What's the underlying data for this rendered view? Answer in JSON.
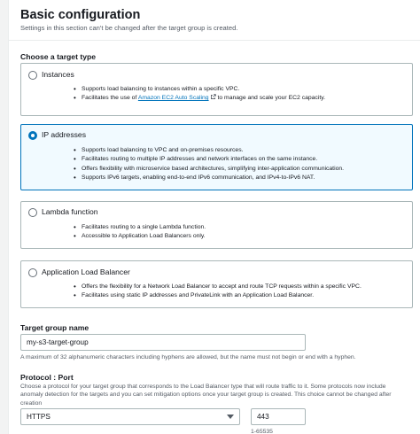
{
  "header": {
    "title": "Basic configuration",
    "subtitle": "Settings in this section can't be changed after the target group is created."
  },
  "target_type": {
    "label": "Choose a target type",
    "options": [
      {
        "label": "Instances",
        "selected": false,
        "bullets": [
          "Supports load balancing to instances within a specific VPC."
        ],
        "autoscaling": {
          "prefix": "Facilitates the use of ",
          "link": "Amazon EC2 Auto Scaling",
          "suffix": " to manage and scale your EC2 capacity."
        }
      },
      {
        "label": "IP addresses",
        "selected": true,
        "bullets": [
          "Supports load balancing to VPC and on-premises resources.",
          "Facilitates routing to multiple IP addresses and network interfaces on the same instance.",
          "Offers flexibility with microservice based architectures, simplifying inter-application communication.",
          "Supports IPv6 targets, enabling end-to-end IPv6 communication, and IPv4-to-IPv6 NAT."
        ]
      },
      {
        "label": "Lambda function",
        "selected": false,
        "bullets": [
          "Facilitates routing to a single Lambda function.",
          "Accessible to Application Load Balancers only."
        ]
      },
      {
        "label": "Application Load Balancer",
        "selected": false,
        "bullets": [
          "Offers the flexibility for a Network Load Balancer to accept and route TCP requests within a specific VPC.",
          "Facilitates using static IP addresses and PrivateLink with an Application Load Balancer."
        ]
      }
    ]
  },
  "target_group_name": {
    "label": "Target group name",
    "value": "my-s3-target-group",
    "hint": "A maximum of 32 alphanumeric characters including hyphens are allowed, but the name must not begin or end with a hyphen."
  },
  "protocol_port": {
    "label": "Protocol : Port",
    "description": "Choose a protocol for your target group that corresponds to the Load Balancer type that will route traffic to it. Some protocols now include anomaly detection for the targets and you can set mitigation options once your target group is created. This choice cannot be changed after creation",
    "protocol_value": "HTTPS",
    "port_value": "443",
    "port_hint": "1-65535"
  },
  "colors": {
    "accent": "#0073bb",
    "border": "#aab7b8",
    "selected_bg": "#f1faff"
  }
}
